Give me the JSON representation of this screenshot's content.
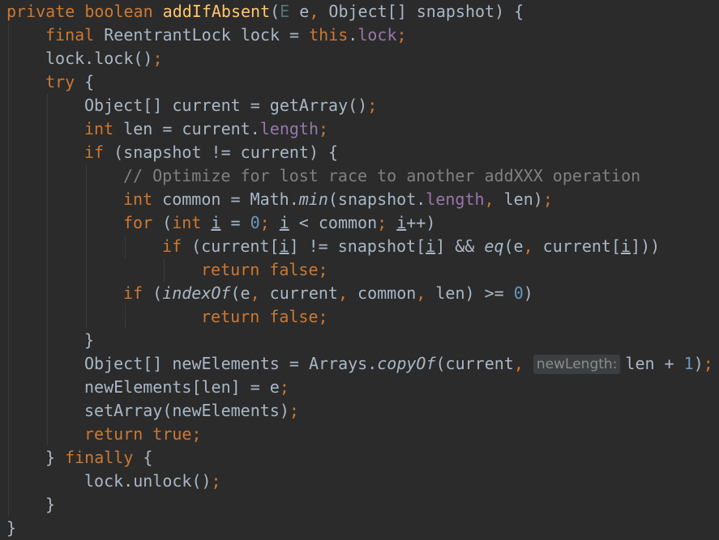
{
  "editor": {
    "language": "java",
    "theme": "darcula",
    "colors": {
      "background": "#2b2b2b",
      "text": "#a9b7c6",
      "keyword": "#cc7832",
      "method_declaration": "#ffc66d",
      "field": "#9876aa",
      "number": "#6897bb",
      "comment": "#808080"
    },
    "lines": [
      [
        {
          "t": "private boolean",
          "c": "kw"
        },
        {
          "t": " "
        },
        {
          "t": "addIfAbsent",
          "c": "fn"
        },
        {
          "t": "("
        },
        {
          "t": "E",
          "c": "gen"
        },
        {
          "t": " e"
        },
        {
          "t": ",",
          "c": "punc"
        },
        {
          "t": " Object[] snapshot) {"
        }
      ],
      [
        {
          "t": "final",
          "c": "kw"
        },
        {
          "t": " ReentrantLock lock = "
        },
        {
          "t": "this",
          "c": "kw"
        },
        {
          "t": "."
        },
        {
          "t": "lock",
          "c": "field"
        },
        {
          "t": ";",
          "c": "punc"
        }
      ],
      [
        {
          "t": "lock.lock()"
        },
        {
          "t": ";",
          "c": "punc"
        }
      ],
      [
        {
          "t": "try",
          "c": "kw"
        },
        {
          "t": " {"
        }
      ],
      [
        {
          "t": "Object[] current = getArray()"
        },
        {
          "t": ";",
          "c": "punc"
        }
      ],
      [
        {
          "t": "int",
          "c": "kw"
        },
        {
          "t": " len = current."
        },
        {
          "t": "length",
          "c": "field"
        },
        {
          "t": ";",
          "c": "punc"
        }
      ],
      [
        {
          "t": "if",
          "c": "kw"
        },
        {
          "t": " (snapshot != current) {"
        }
      ],
      [
        {
          "t": "// Optimize for lost race to another addXXX operation",
          "c": "cm"
        }
      ],
      [
        {
          "t": "int",
          "c": "kw"
        },
        {
          "t": " common = Math."
        },
        {
          "t": "min",
          "c": "it"
        },
        {
          "t": "(snapshot."
        },
        {
          "t": "length",
          "c": "field"
        },
        {
          "t": ",",
          "c": "punc"
        },
        {
          "t": " len)"
        },
        {
          "t": ";",
          "c": "punc"
        }
      ],
      [
        {
          "t": "for",
          "c": "kw"
        },
        {
          "t": " ("
        },
        {
          "t": "int",
          "c": "kw"
        },
        {
          "t": " "
        },
        {
          "t": "i",
          "c": "ul"
        },
        {
          "t": " = "
        },
        {
          "t": "0",
          "c": "num"
        },
        {
          "t": ";",
          "c": "punc"
        },
        {
          "t": " "
        },
        {
          "t": "i",
          "c": "ul"
        },
        {
          "t": " < common"
        },
        {
          "t": ";",
          "c": "punc"
        },
        {
          "t": " "
        },
        {
          "t": "i",
          "c": "ul"
        },
        {
          "t": "++)"
        }
      ],
      [
        {
          "t": "if",
          "c": "kw"
        },
        {
          "t": " (current["
        },
        {
          "t": "i",
          "c": "ul"
        },
        {
          "t": "] != snapshot["
        },
        {
          "t": "i",
          "c": "ul"
        },
        {
          "t": "] && "
        },
        {
          "t": "eq",
          "c": "it"
        },
        {
          "t": "(e"
        },
        {
          "t": ",",
          "c": "punc"
        },
        {
          "t": " current["
        },
        {
          "t": "i",
          "c": "ul"
        },
        {
          "t": "]))"
        }
      ],
      [
        {
          "t": "return false",
          "c": "kw"
        },
        {
          "t": ";",
          "c": "punc"
        }
      ],
      [
        {
          "t": "if",
          "c": "kw"
        },
        {
          "t": " ("
        },
        {
          "t": "indexOf",
          "c": "it"
        },
        {
          "t": "(e"
        },
        {
          "t": ",",
          "c": "punc"
        },
        {
          "t": " current"
        },
        {
          "t": ",",
          "c": "punc"
        },
        {
          "t": " common"
        },
        {
          "t": ",",
          "c": "punc"
        },
        {
          "t": " len) >= "
        },
        {
          "t": "0",
          "c": "num"
        },
        {
          "t": ")"
        }
      ],
      [
        {
          "t": "return false",
          "c": "kw"
        },
        {
          "t": ";",
          "c": "punc"
        }
      ],
      [
        {
          "t": "}"
        }
      ],
      [
        {
          "t": "Object[] newElements = Arrays."
        },
        {
          "t": "copyOf",
          "c": "it"
        },
        {
          "t": "(current"
        },
        {
          "t": ",",
          "c": "punc"
        },
        {
          "t": " "
        },
        {
          "t": "newLength:",
          "c": "hint"
        },
        {
          "t": "len + "
        },
        {
          "t": "1",
          "c": "num"
        },
        {
          "t": ")"
        },
        {
          "t": ";",
          "c": "punc"
        }
      ],
      [
        {
          "t": "newElements[len] = e"
        },
        {
          "t": ";",
          "c": "punc"
        }
      ],
      [
        {
          "t": "setArray(newElements)"
        },
        {
          "t": ";",
          "c": "punc"
        }
      ],
      [
        {
          "t": "return true",
          "c": "kw"
        },
        {
          "t": ";",
          "c": "punc"
        }
      ],
      [
        {
          "t": "} "
        },
        {
          "t": "finally",
          "c": "kw"
        },
        {
          "t": " {"
        }
      ],
      [
        {
          "t": "lock.unlock()"
        },
        {
          "t": ";",
          "c": "punc"
        }
      ],
      [
        {
          "t": "}"
        }
      ],
      [
        {
          "t": "}"
        }
      ]
    ],
    "indent_levels": [
      0,
      1,
      1,
      1,
      2,
      2,
      2,
      3,
      3,
      3,
      4,
      5,
      3,
      5,
      2,
      2,
      2,
      2,
      2,
      1,
      2,
      1,
      0
    ]
  }
}
